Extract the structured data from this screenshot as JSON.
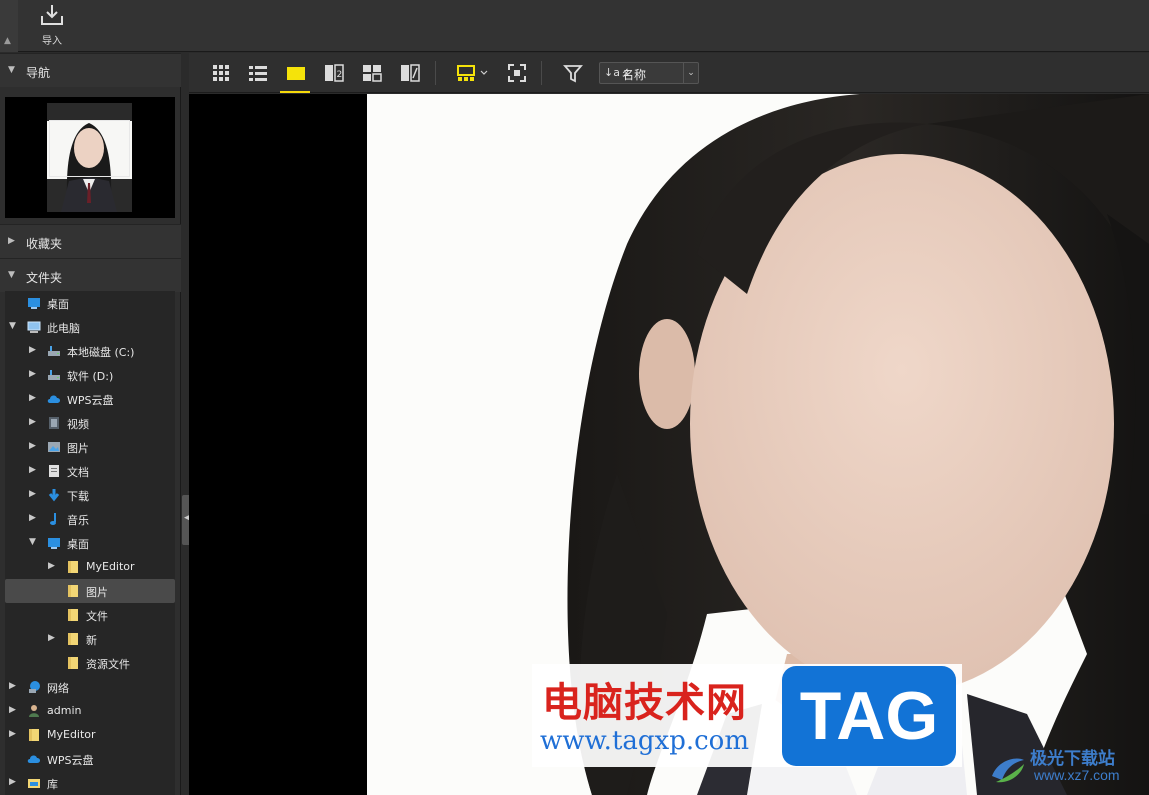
{
  "topbar": {
    "import_label": "导入"
  },
  "panels": {
    "navigation": "导航",
    "favorites": "收藏夹",
    "folders": "文件夹"
  },
  "tree": [
    {
      "label": "桌面",
      "level": 0,
      "arrow": "",
      "icon": "desktop-icon"
    },
    {
      "label": "此电脑",
      "level": 0,
      "arrow": "▼",
      "icon": "computer-icon"
    },
    {
      "label": "本地磁盘 (C:)",
      "level": 1,
      "arrow": "▶",
      "icon": "drive-icon"
    },
    {
      "label": "软件 (D:)",
      "level": 1,
      "arrow": "▶",
      "icon": "drive-icon"
    },
    {
      "label": "WPS云盘",
      "level": 1,
      "arrow": "▶",
      "icon": "cloud-icon"
    },
    {
      "label": "视频",
      "level": 1,
      "arrow": "▶",
      "icon": "video-icon"
    },
    {
      "label": "图片",
      "level": 1,
      "arrow": "▶",
      "icon": "pictures-icon"
    },
    {
      "label": "文档",
      "level": 1,
      "arrow": "▶",
      "icon": "document-icon"
    },
    {
      "label": "下载",
      "level": 1,
      "arrow": "▶",
      "icon": "download-icon"
    },
    {
      "label": "音乐",
      "level": 1,
      "arrow": "▶",
      "icon": "music-icon"
    },
    {
      "label": "桌面",
      "level": 1,
      "arrow": "▼",
      "icon": "desktop-icon"
    },
    {
      "label": "MyEditor",
      "level": 2,
      "arrow": "▶",
      "icon": "folder-icon"
    },
    {
      "label": "图片",
      "level": 2,
      "arrow": "",
      "icon": "folder-icon",
      "selected": true
    },
    {
      "label": "文件",
      "level": 2,
      "arrow": "",
      "icon": "folder-icon"
    },
    {
      "label": "新",
      "level": 2,
      "arrow": "▶",
      "icon": "folder-icon"
    },
    {
      "label": "资源文件",
      "level": 2,
      "arrow": "",
      "icon": "folder-icon"
    },
    {
      "label": "网络",
      "level": 0,
      "arrow": "▶",
      "icon": "network-icon"
    },
    {
      "label": "admin",
      "level": 0,
      "arrow": "▶",
      "icon": "user-icon"
    },
    {
      "label": "MyEditor",
      "level": 0,
      "arrow": "▶",
      "icon": "folder-icon"
    },
    {
      "label": "WPS云盘",
      "level": 0,
      "arrow": "",
      "icon": "cloud-icon"
    },
    {
      "label": "库",
      "level": 0,
      "arrow": "▶",
      "icon": "library-icon"
    }
  ],
  "toolbar": {
    "sort_label": "名称",
    "sort_icon": "↓a z"
  },
  "watermark": {
    "cn": "电脑技术网",
    "url": "www.tagxp.com",
    "tag": "TAG",
    "brand_name": "极光下载站",
    "brand_site": "www.xz7.com"
  },
  "colors": {
    "accent": "#f5d90a",
    "folder": "#f2d675",
    "blue": "#2b8fe0"
  }
}
